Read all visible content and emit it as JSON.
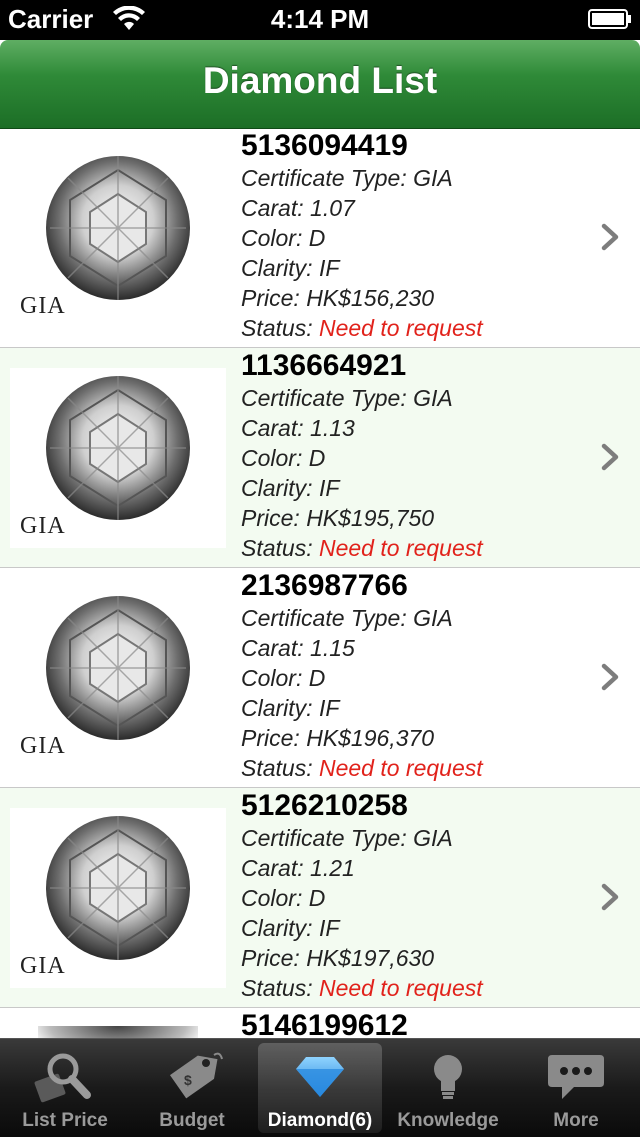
{
  "status_bar": {
    "carrier": "Carrier",
    "time": "4:14 PM"
  },
  "nav": {
    "title": "Diamond List"
  },
  "labels": {
    "certificate_type": "Certificate Type: ",
    "carat": "Carat: ",
    "color": "Color: ",
    "clarity": "Clarity: ",
    "price": "Price: ",
    "status": "Status: "
  },
  "diamonds": [
    {
      "stock_number": "5136094419",
      "certificate_type": "GIA",
      "carat": "1.07",
      "color": "D",
      "clarity": "IF",
      "price": "HK$156,230",
      "status": "Need to request",
      "image_label": "GIA"
    },
    {
      "stock_number": "1136664921",
      "certificate_type": "GIA",
      "carat": "1.13",
      "color": "D",
      "clarity": "IF",
      "price": "HK$195,750",
      "status": "Need to request",
      "image_label": "GIA"
    },
    {
      "stock_number": "2136987766",
      "certificate_type": "GIA",
      "carat": "1.15",
      "color": "D",
      "clarity": "IF",
      "price": "HK$196,370",
      "status": "Need to request",
      "image_label": "GIA"
    },
    {
      "stock_number": "5126210258",
      "certificate_type": "GIA",
      "carat": "1.21",
      "color": "D",
      "clarity": "IF",
      "price": "HK$197,630",
      "status": "Need to request",
      "image_label": "GIA"
    },
    {
      "stock_number": "5146199612"
    }
  ],
  "tabs": [
    {
      "label": "List Price",
      "icon": "magnifier-icon",
      "selected": false
    },
    {
      "label": "Budget",
      "icon": "price-tag-icon",
      "selected": false
    },
    {
      "label": "Diamond(6)",
      "icon": "diamond-icon",
      "selected": true
    },
    {
      "label": "Knowledge",
      "icon": "lightbulb-icon",
      "selected": false
    },
    {
      "label": "More",
      "icon": "speech-bubble-icon",
      "selected": false
    }
  ],
  "colors": {
    "nav_green": "#2f8a38",
    "status_red": "#e1221b",
    "alt_row": "#f3fbf1",
    "tab_selected_blue": "#3aa3ee"
  }
}
